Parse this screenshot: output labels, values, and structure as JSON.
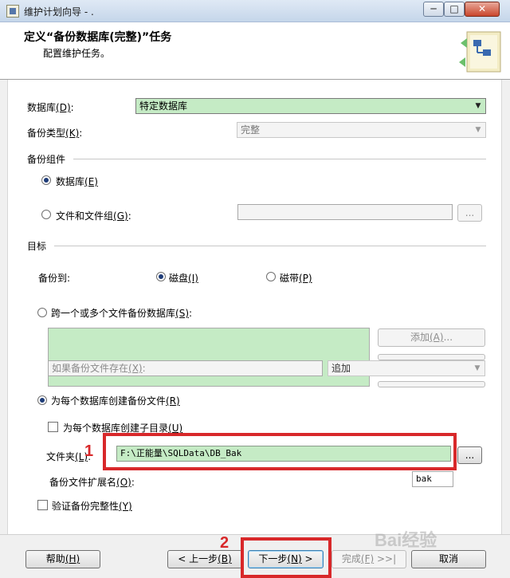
{
  "window": {
    "title": "维护计划向导 - .",
    "min": "─",
    "max": "□",
    "close": "✕"
  },
  "header": {
    "title": "定义“备份数据库(完整)”任务",
    "subtitle": "配置维护任务。"
  },
  "database": {
    "label": "数据库",
    "key": "(D)",
    "colon": ":",
    "value": "特定数据库"
  },
  "backup_type": {
    "label": "备份类型",
    "key": "(K)",
    "colon": ":",
    "value": "完整"
  },
  "backup_component": {
    "section": "备份组件",
    "database_option": {
      "label": "数据库",
      "key": "(E)"
    },
    "files_option": {
      "label": "文件和文件组",
      "key": "(G)",
      "colon": ":"
    },
    "browse": "..."
  },
  "destination": {
    "section": "目标",
    "backup_to": "备份到:",
    "disk": {
      "label": "磁盘",
      "key": "(I)"
    },
    "tape": {
      "label": "磁带",
      "key": "(P)"
    },
    "span_option": {
      "label": "跨一个或多个文件备份数据库",
      "key": "(S)",
      "colon": ":"
    },
    "add_button": {
      "label": "添加",
      "key": "(A)",
      "suffix": "..."
    },
    "if_exists": {
      "label": "如果备份文件存在",
      "key": "(X)",
      "colon": ":",
      "value": "追加"
    },
    "per_db_option": {
      "label": "为每个数据库创建备份文件",
      "key": "(R)"
    },
    "subdir": {
      "label": "为每个数据库创建子目录",
      "key": "(U)"
    },
    "folder": {
      "label": "文件夹",
      "key": "(L)",
      "colon": ":",
      "value": "F:\\正能量\\SQLData\\DB_Bak",
      "browse": "..."
    },
    "extension": {
      "label": "备份文件扩展名",
      "key": "(O)",
      "colon": ":",
      "value": "bak"
    }
  },
  "verify": {
    "label": "验证备份完整性",
    "key": "(Y)"
  },
  "footer": {
    "help": {
      "label": "帮助",
      "key": "(H)"
    },
    "back": {
      "label": "< 上一步",
      "key": "(B)"
    },
    "next": {
      "label": "下一步",
      "key": "(N)",
      "suffix": " >"
    },
    "finish": {
      "label": "完成",
      "key": "(F)",
      "suffix": " >>|"
    },
    "cancel": {
      "label": "取消"
    }
  },
  "annotations": {
    "mark1": "1",
    "mark2": "2"
  },
  "watermark": "Bai经验",
  "colors": {
    "highlight": "#d8282a",
    "field_green": "#c5ebc5"
  }
}
